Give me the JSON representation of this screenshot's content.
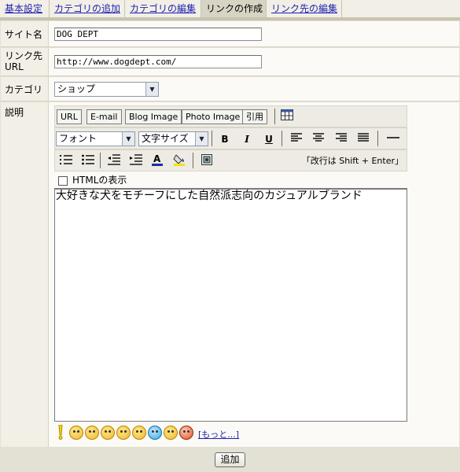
{
  "tabs": [
    {
      "label": "基本設定",
      "active": false
    },
    {
      "label": "カテゴリの追加",
      "active": false
    },
    {
      "label": "カテゴリの編集",
      "active": false
    },
    {
      "label": "リンクの作成",
      "active": true
    },
    {
      "label": "リンク先の編集",
      "active": false
    }
  ],
  "form": {
    "site_name_label": "サイト名",
    "site_name_value": "DOG DEPT",
    "url_label": "リンク先URL",
    "url_value": "http://www.dogdept.com/",
    "category_label": "カテゴリ",
    "category_value": "ショップ",
    "description_label": "説明"
  },
  "toolbar": {
    "row1_buttons": [
      "URL",
      "E-mail",
      "Blog Image",
      "Photo Image",
      "引用"
    ],
    "font_select": "フォント",
    "size_select": "文字サイズ",
    "bold": "B",
    "italic": "I",
    "underline": "U",
    "enter_hint": "「改行は Shift + Enter」"
  },
  "editor": {
    "html_toggle_label": "HTMLの表示",
    "content": "大好きな犬をモチーフにした自然派志向のカジュアルブランド",
    "more_link": "[もっと...]"
  },
  "colors": {
    "tab_active_bg": "#d8d4c4",
    "link_blue": "#1f1fb0",
    "label_bg": "#f1efe6"
  },
  "submit_label": "追加"
}
